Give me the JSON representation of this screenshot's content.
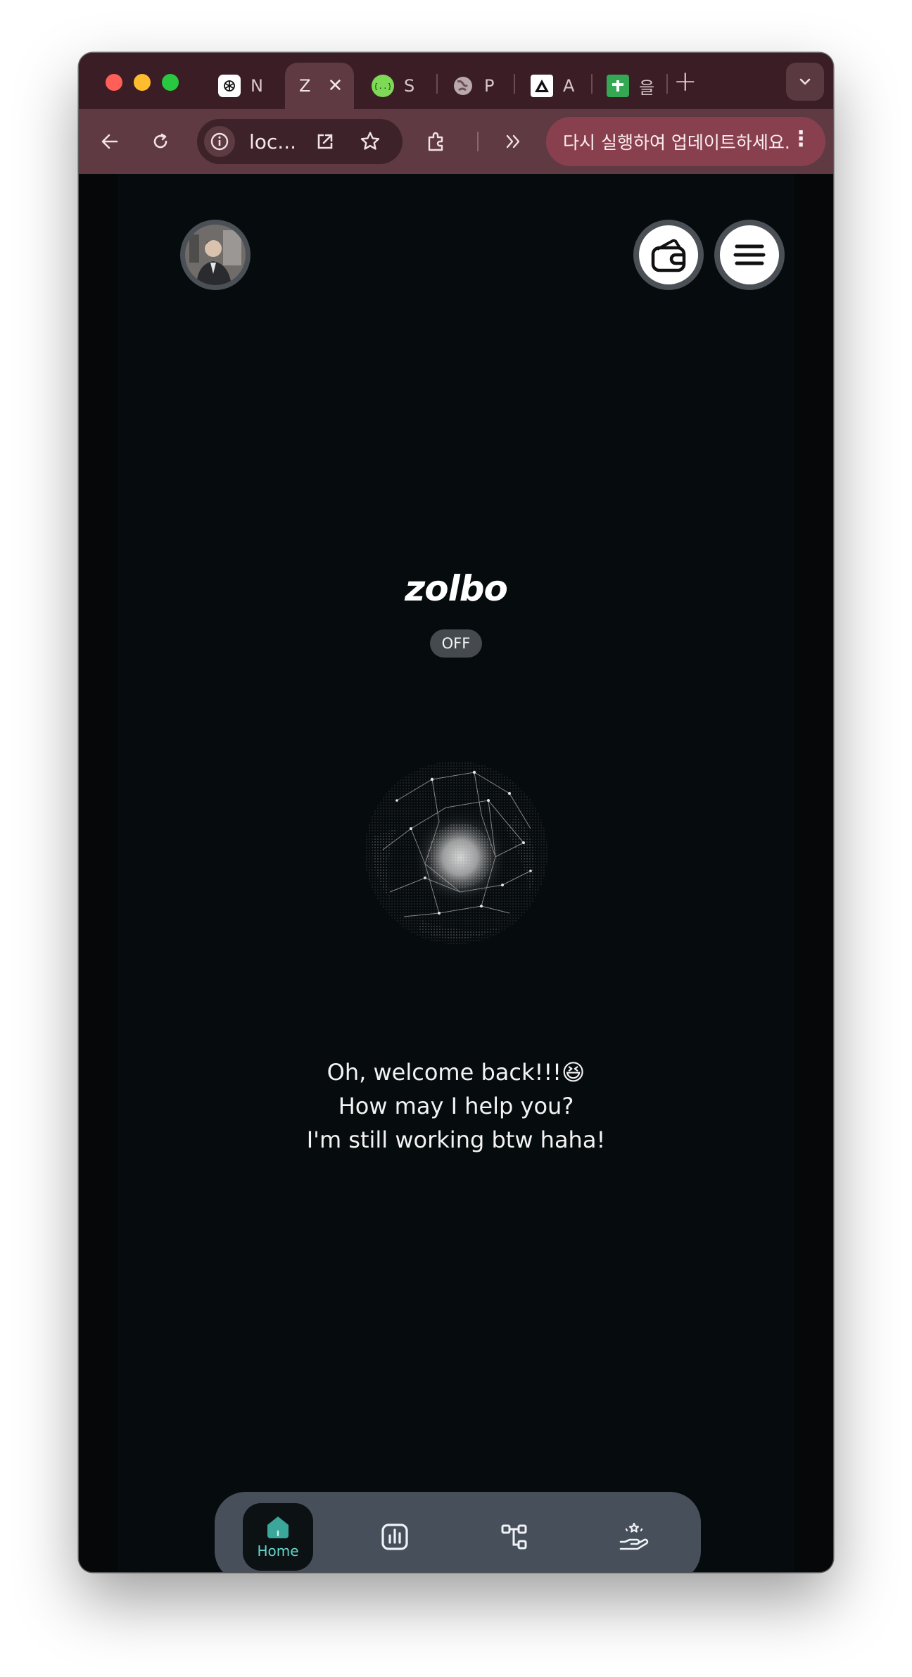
{
  "browser": {
    "tabs": [
      {
        "title": "N",
        "favicon": "chatgpt-icon",
        "active": false
      },
      {
        "title": "Z",
        "favicon": "none",
        "active": true
      },
      {
        "title": "S",
        "favicon": "code-braces-icon",
        "active": false
      },
      {
        "title": "P",
        "favicon": "globe-icon",
        "active": false
      },
      {
        "title": "A",
        "favicon": "triangle-logo-icon",
        "active": false
      },
      {
        "title": "을",
        "favicon": "sheets-plus-icon",
        "active": false
      }
    ],
    "new_tab_label": "+",
    "close_tab_label": "✕",
    "address": "loc...",
    "update_message": "다시 실행하여 업데이트하세요.",
    "colors": {
      "frame": "#3b1e25",
      "toolbar": "#5f3a43",
      "update_pill": "#89404e"
    }
  },
  "app": {
    "brand": "zolbo",
    "status_badge": "OFF",
    "welcome_lines": [
      "Oh, welcome back!!!😆",
      "How may I help you?",
      "I'm still working btw haha!"
    ],
    "header": {
      "avatar_icon": "user-avatar",
      "wallet_icon": "wallet-icon",
      "menu_icon": "hamburger-menu-icon"
    },
    "bottom_nav": {
      "items": [
        {
          "label": "Home",
          "icon": "home-icon",
          "active": true
        },
        {
          "label": "",
          "icon": "bar-chart-icon",
          "active": false
        },
        {
          "label": "",
          "icon": "workflow-icon",
          "active": false
        },
        {
          "label": "",
          "icon": "hand-stars-icon",
          "active": false
        }
      ],
      "accent_color": "#65d6c9"
    },
    "colors": {
      "background": "#060b0e",
      "nav_background": "#464f5a"
    }
  }
}
